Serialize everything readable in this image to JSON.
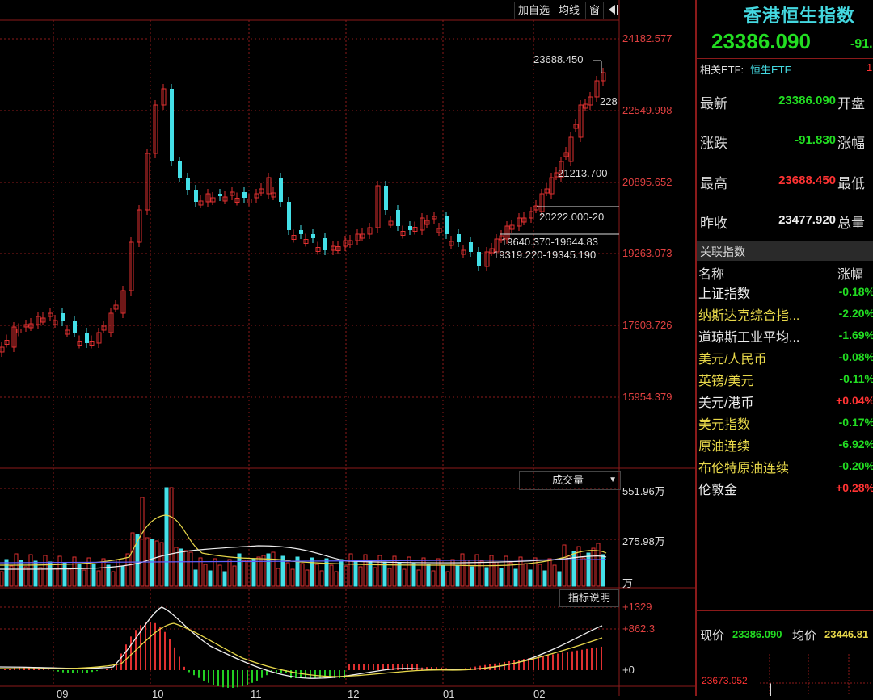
{
  "toolbar": {
    "add_watch": "加自选",
    "ma_lines": "均线",
    "window": "窗",
    "arrow": "arrow-right-bar-icon"
  },
  "price_axis": [
    "24182.577",
    "22549.998",
    "20895.652",
    "19263.073",
    "17608.726",
    "15954.379"
  ],
  "price_annotations": {
    "high": "23688.450",
    "right_cut": "228",
    "a1": "21213.700-",
    "a2": "20222.000-20",
    "a3": "19640.370-19644.83",
    "a4": "19319.220-19345.190"
  },
  "volume": {
    "selector_label": "成交量",
    "axis": [
      "551.96万",
      "275.98万",
      "万"
    ]
  },
  "indicator": {
    "button": "指标说明",
    "axis": [
      "+1329",
      "+862.3",
      "+0"
    ]
  },
  "xaxis_labels": [
    "09",
    "10",
    "11",
    "12",
    "01",
    "02"
  ],
  "quote": {
    "title": "香港恒生指数",
    "price": "23386.090",
    "change_cut": "-91.",
    "etf_label": "相关ETF:",
    "etf_name": "恒生ETF",
    "etf_right": "1",
    "rows": [
      {
        "k": "最新",
        "v": "23386.090",
        "k2": "开盘",
        "color": "green"
      },
      {
        "k": "涨跌",
        "v": "-91.830",
        "k2": "涨幅",
        "color": "green"
      },
      {
        "k": "最高",
        "v": "23688.450",
        "k2": "最低",
        "color": "red"
      },
      {
        "k": "昨收",
        "v": "23477.920",
        "k2": "总量",
        "color": "white"
      }
    ]
  },
  "related": {
    "header": "关联指数",
    "col_name": "名称",
    "col_change": "涨幅",
    "items": [
      {
        "name": "上证指数",
        "change": "-0.18%",
        "nc": "white",
        "cc": "green"
      },
      {
        "name": "纳斯达克综合指...",
        "change": "-2.20%",
        "nc": "yellow",
        "cc": "green"
      },
      {
        "name": "道琼斯工业平均...",
        "change": "-1.69%",
        "nc": "white",
        "cc": "green"
      },
      {
        "name": "美元/人民币",
        "change": "-0.08%",
        "nc": "yellow",
        "cc": "green"
      },
      {
        "name": "英镑/美元",
        "change": "-0.11%",
        "nc": "yellow",
        "cc": "green"
      },
      {
        "name": "美元/港币",
        "change": "+0.04%",
        "nc": "white",
        "cc": "red"
      },
      {
        "name": "美元指数",
        "change": "-0.17%",
        "nc": "yellow",
        "cc": "green"
      },
      {
        "name": "原油连续",
        "change": "-6.92%",
        "nc": "yellow",
        "cc": "green"
      },
      {
        "name": "布伦特原油连续",
        "change": "-0.20%",
        "nc": "yellow",
        "cc": "green"
      },
      {
        "name": "伦敦金",
        "change": "+0.28%",
        "nc": "white",
        "cc": "red"
      }
    ]
  },
  "intraday": {
    "now_label": "现价",
    "now_value": "23386.090",
    "avg_label": "均价",
    "avg_value": "23446.81",
    "axis_top": "23673.052"
  },
  "colors": {
    "up": "#e03030",
    "down": "#44e0e8",
    "grid": "#8b1a1a"
  }
}
